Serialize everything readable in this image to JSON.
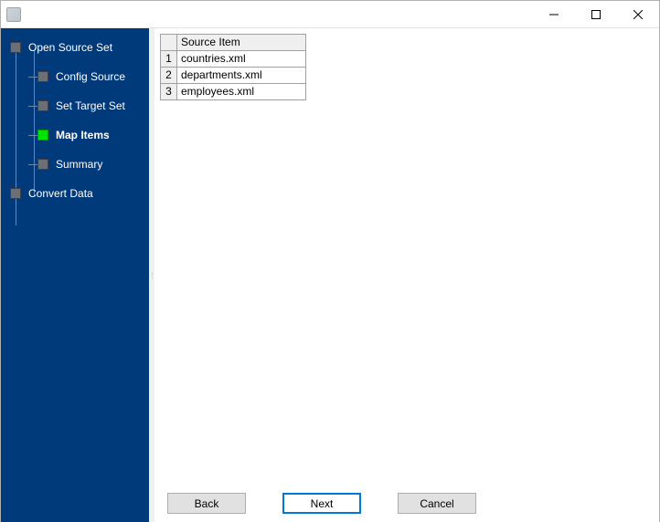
{
  "window": {
    "title": ""
  },
  "sidebar": {
    "items": [
      {
        "label": "Open Source Set",
        "level": 0,
        "active": false,
        "bold": false
      },
      {
        "label": "Config Source",
        "level": 1,
        "active": false,
        "bold": false
      },
      {
        "label": "Set Target Set",
        "level": 1,
        "active": false,
        "bold": false
      },
      {
        "label": "Map Items",
        "level": 1,
        "active": true,
        "bold": true
      },
      {
        "label": "Summary",
        "level": 1,
        "active": false,
        "bold": false
      },
      {
        "label": "Convert Data",
        "level": 0,
        "active": false,
        "bold": false
      }
    ]
  },
  "grid": {
    "header": "Source Item",
    "rows": [
      {
        "n": "1",
        "item": "countries.xml"
      },
      {
        "n": "2",
        "item": "departments.xml"
      },
      {
        "n": "3",
        "item": "employees.xml"
      }
    ]
  },
  "buttons": {
    "back": "Back",
    "next": "Next",
    "cancel": "Cancel"
  }
}
